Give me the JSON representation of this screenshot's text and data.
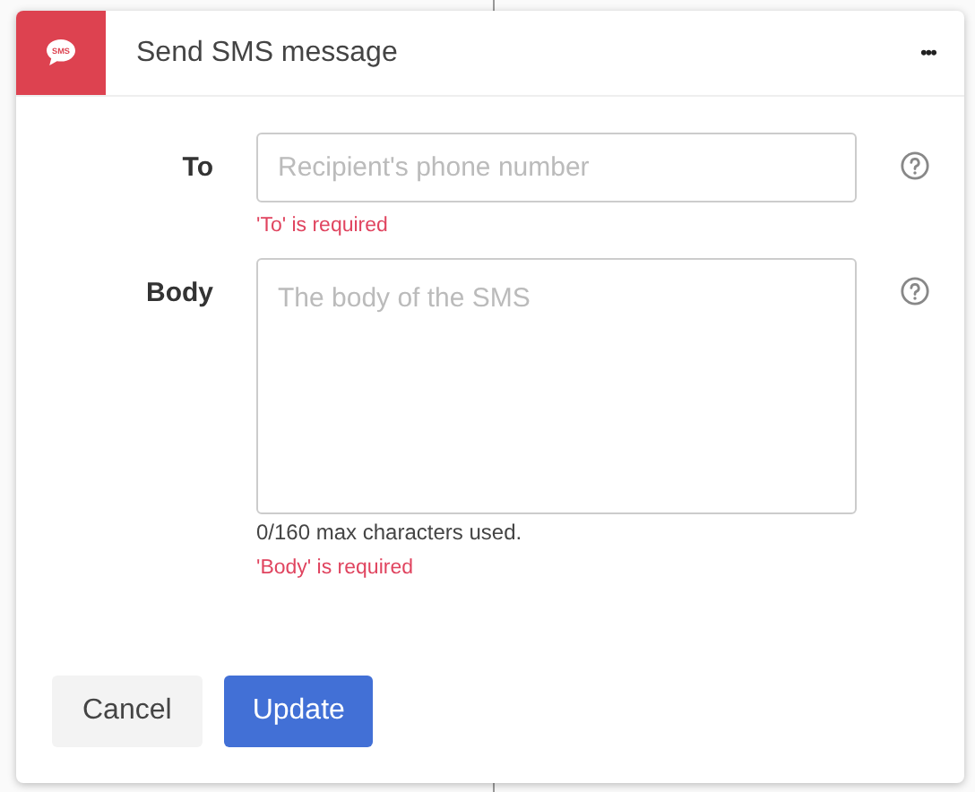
{
  "header": {
    "icon_label": "SMS",
    "title": "Send SMS message",
    "menu": "•••"
  },
  "fields": [
    {
      "kind": "input",
      "label": "To",
      "placeholder": "Recipient's phone number",
      "error": "'To' is required"
    },
    {
      "kind": "textarea",
      "label": "Body",
      "placeholder": "The body of the SMS",
      "hint": "0/160 max characters used.",
      "error": "'Body' is required"
    }
  ],
  "buttons": [
    {
      "label": "Cancel",
      "kind": "secondary"
    },
    {
      "label": "Update",
      "kind": "primary"
    }
  ]
}
